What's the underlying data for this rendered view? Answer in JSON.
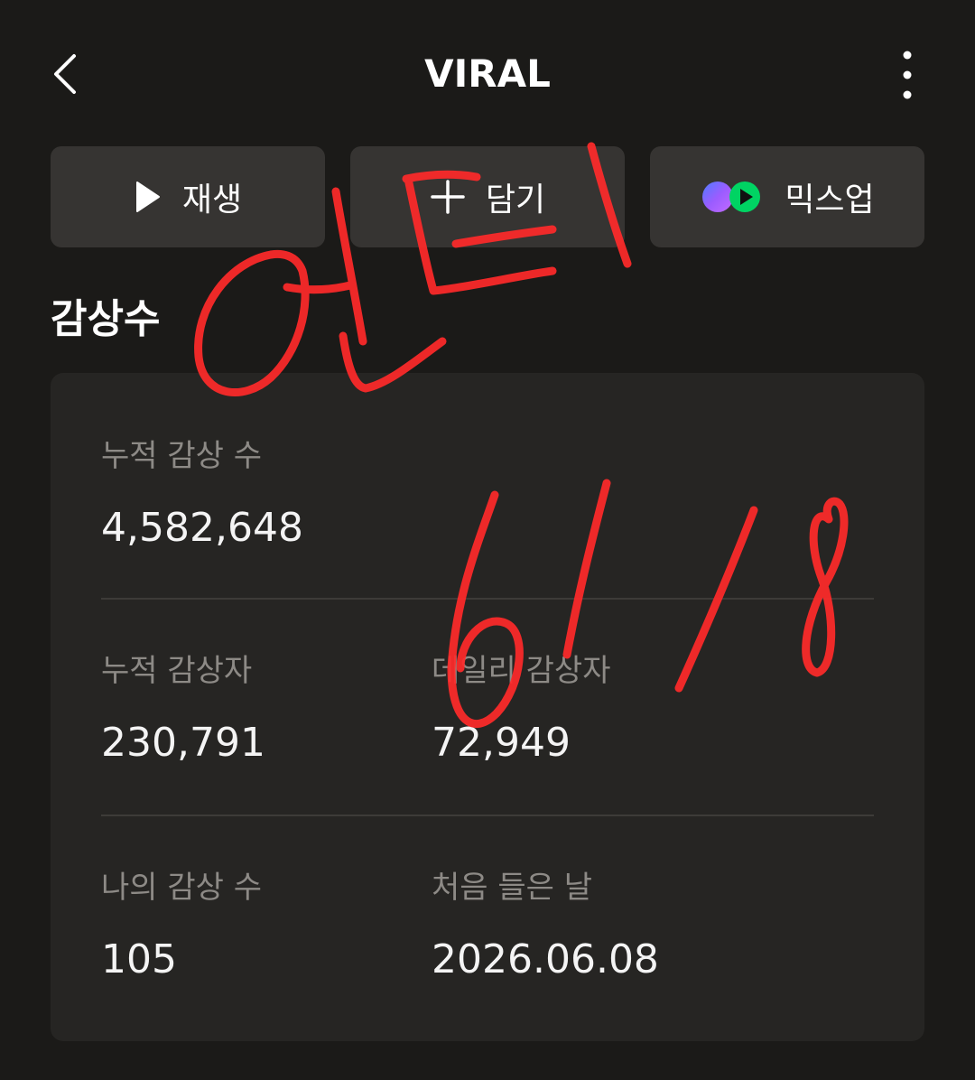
{
  "header": {
    "title": "VIRAL"
  },
  "actions": {
    "play_label": "재생",
    "add_label": "담기",
    "mixup_label": "믹스업"
  },
  "section": {
    "title": "감상수"
  },
  "stats": {
    "total_plays_label": "누적 감상 수",
    "total_plays_value": "4,582,648",
    "total_listeners_label": "누적 감상자",
    "total_listeners_value": "230,791",
    "daily_listeners_label": "데일리 감상자",
    "daily_listeners_value": "72,949",
    "my_plays_label": "나의 감상 수",
    "my_plays_value": "105",
    "first_listened_label": "처음 들은 날",
    "first_listened_value": "2026.06.08"
  },
  "annotation": {
    "handwriting": "언더 6/18",
    "color": "#ff2a2a"
  },
  "colors": {
    "background": "#1b1a18",
    "button_bg": "#363432",
    "card_bg": "#262523",
    "label_gray": "#8d8a86",
    "mixup_purple": "#8a63ff",
    "mixup_green": "#00d463"
  }
}
